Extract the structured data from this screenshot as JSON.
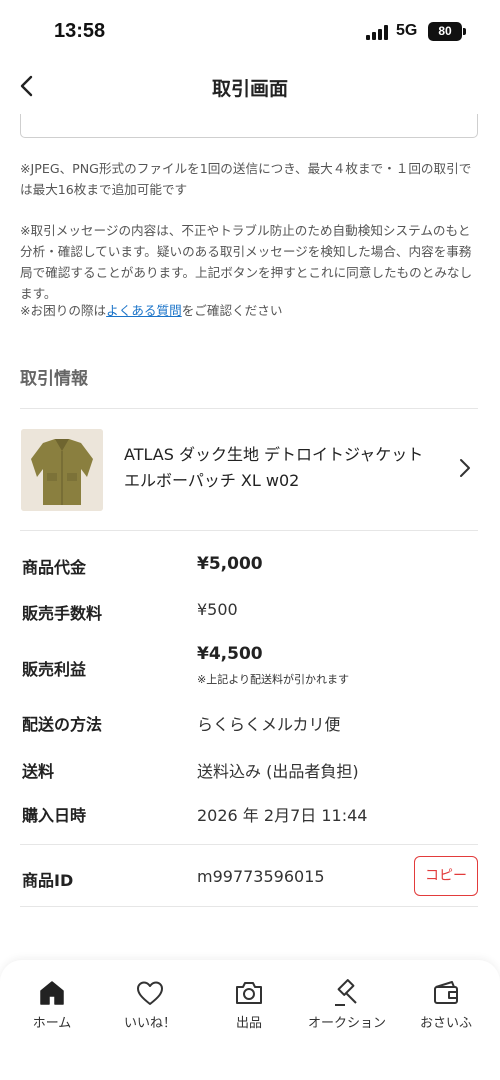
{
  "status_bar": {
    "time": "13:58",
    "network": "5G",
    "battery": "80"
  },
  "nav": {
    "title": "取引画面"
  },
  "notes": {
    "upload_note": "※JPEG、PNG形式のファイルを1回の送信につき、最大４枚まで・１回の取引では最大16枚まで追加可能です",
    "message_note": "※取引メッセージの内容は、不正やトラブル防止のため自動検知システムのもと分析・確認しています。疑いのある取引メッセージを検知した場合、内容を事務局で確認することがあります。上記ボタンを押すとこれに同意したものとみなします。",
    "help_prefix": "※お困りの際は",
    "help_link": "よくある質問",
    "help_suffix": "をご確認ください"
  },
  "transaction": {
    "section_title": "取引情報",
    "item_name": "ATLAS ダック生地 デトロイトジャケット エルボーパッチ XL w02",
    "rows": [
      {
        "label": "商品代金",
        "value": "¥5,000"
      },
      {
        "label": "販売手数料",
        "value": "¥500"
      },
      {
        "label": "販売利益",
        "value": "¥4,500",
        "note": "※上記より配送料が引かれます"
      },
      {
        "label": "配送の方法",
        "value": "らくらくメルカリ便"
      },
      {
        "label": "送料",
        "value": "送料込み (出品者負担)"
      },
      {
        "label": "購入日時",
        "value": "2026 年 2月7日 11:44"
      },
      {
        "label": "商品ID",
        "value": "m99773596015"
      }
    ],
    "copy_label": "コピー"
  },
  "tabbar": {
    "items": [
      {
        "label": "ホーム",
        "icon": "home-icon"
      },
      {
        "label": "いいね！",
        "icon": "heart-icon"
      },
      {
        "label": "出品",
        "icon": "camera-icon"
      },
      {
        "label": "オークション",
        "icon": "gavel-icon"
      },
      {
        "label": "おさいふ",
        "icon": "wallet-icon"
      }
    ]
  },
  "colors": {
    "accent_red": "#e23b3b",
    "link_blue": "#1a73c8"
  }
}
